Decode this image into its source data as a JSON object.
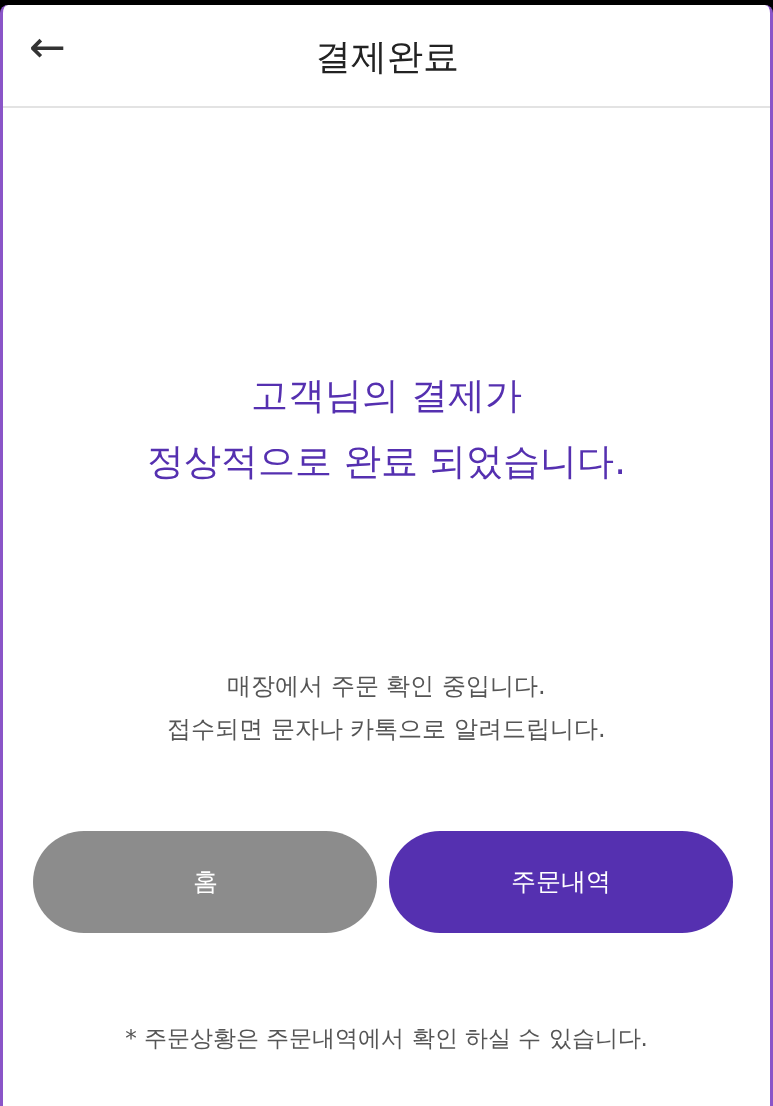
{
  "header": {
    "back_icon": "←",
    "title": "결제완료"
  },
  "message": {
    "headline_lines": [
      "고객님의 결제가",
      "정상적으로 완료 되었습니다."
    ],
    "detail_lines": [
      "매장에서 주문 확인 중입니다.",
      "접수되면 문자나 카톡으로 알려드립니다."
    ]
  },
  "buttons": [
    {
      "label": "홈",
      "kind": "secondary"
    },
    {
      "label": "주문내역",
      "kind": "primary"
    }
  ],
  "note": "* 주문상황은 주문내역에서 확인 하실 수 있습니다."
}
